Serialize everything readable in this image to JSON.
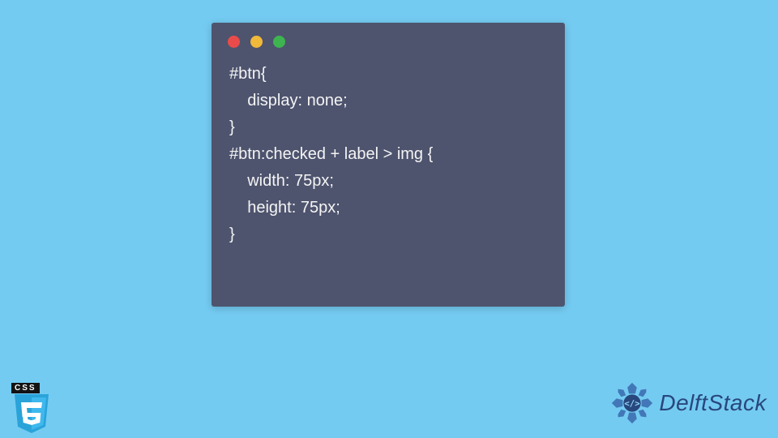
{
  "code": {
    "line1": "#btn{",
    "line2": "    display: none;",
    "line3": "}",
    "line4": "#btn:checked + label > img {",
    "line5": "    width: 75px;",
    "line6": "    height: 75px;",
    "line7": "}"
  },
  "css_badge": {
    "label": "CSS",
    "version": "3"
  },
  "logo": {
    "brand": "DelftStack"
  },
  "colors": {
    "page_bg": "#74cbf2",
    "window_bg": "#4e546e",
    "code_text": "#f4f4f4",
    "brand_text": "#28477d",
    "css_shield": "#2aa3d9"
  }
}
